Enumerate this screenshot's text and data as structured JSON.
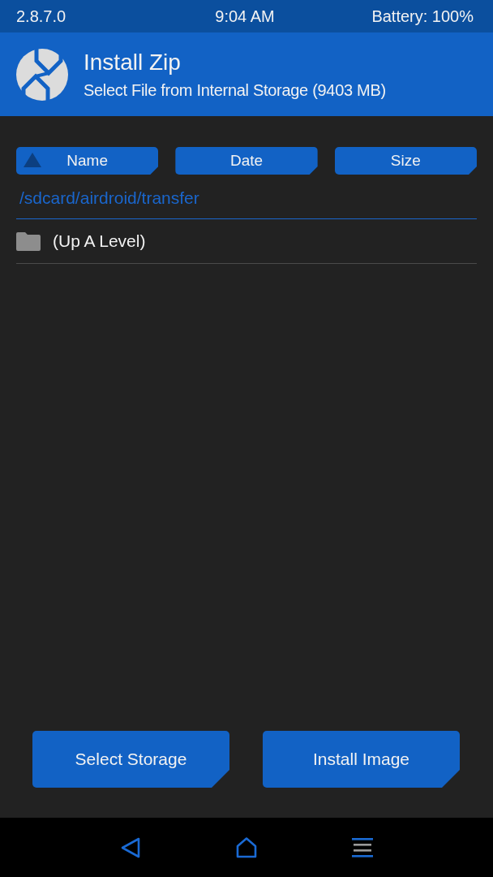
{
  "status_bar": {
    "version": "2.8.7.0",
    "time": "9:04 AM",
    "battery": "Battery: 100%"
  },
  "header": {
    "title": "Install Zip",
    "subtitle": "Select File from Internal Storage (9403 MB)"
  },
  "sort_buttons": [
    {
      "label": "Name",
      "selected": true
    },
    {
      "label": "Date",
      "selected": false
    },
    {
      "label": "Size",
      "selected": false
    }
  ],
  "path": "/sdcard/airdroid/transfer",
  "files": [
    {
      "kind": "folder",
      "name": "(Up A Level)"
    }
  ],
  "buttons": [
    {
      "label": "Select Storage"
    },
    {
      "label": "Install Image"
    }
  ]
}
